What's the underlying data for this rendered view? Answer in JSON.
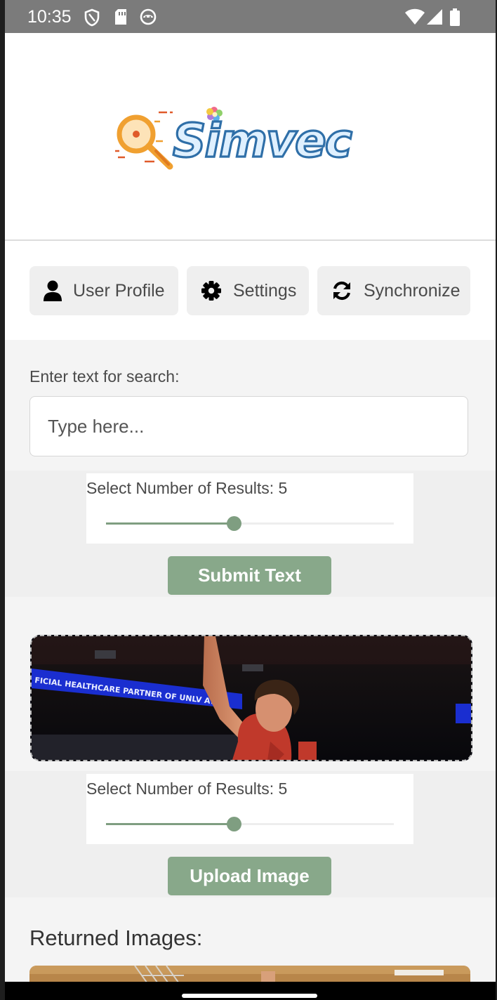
{
  "status_bar": {
    "time": "10:35",
    "icons": [
      "shield-icon",
      "sim-card-icon",
      "android-face-icon",
      "wifi-icon",
      "cell-signal-icon",
      "battery-icon"
    ]
  },
  "header": {
    "logo_text": "Simvec"
  },
  "nav": {
    "user_profile_label": "User Profile",
    "settings_label": "Settings",
    "synchronize_label": "Synchronize"
  },
  "text_search": {
    "label": "Enter text for search:",
    "placeholder": "Type here...",
    "value": "",
    "slider_label": "Select Number of Results: 5",
    "results_value": 5,
    "slider_fraction": 0.44,
    "submit_label": "Submit Text"
  },
  "image_search": {
    "slider_label": "Select Number of Results: 5",
    "results_value": 5,
    "slider_fraction": 0.44,
    "upload_label": "Upload Image",
    "banner_text": "FICIAL HEALTHCARE PARTNER OF UNLV ATHL"
  },
  "results": {
    "title": "Returned Images:"
  },
  "colors": {
    "accent": "#88a88a",
    "slider": "#7f9e81",
    "status_bar": "#7b7b7b",
    "logo_blue": "#2f6fa8",
    "logo_orange": "#f0a030"
  }
}
